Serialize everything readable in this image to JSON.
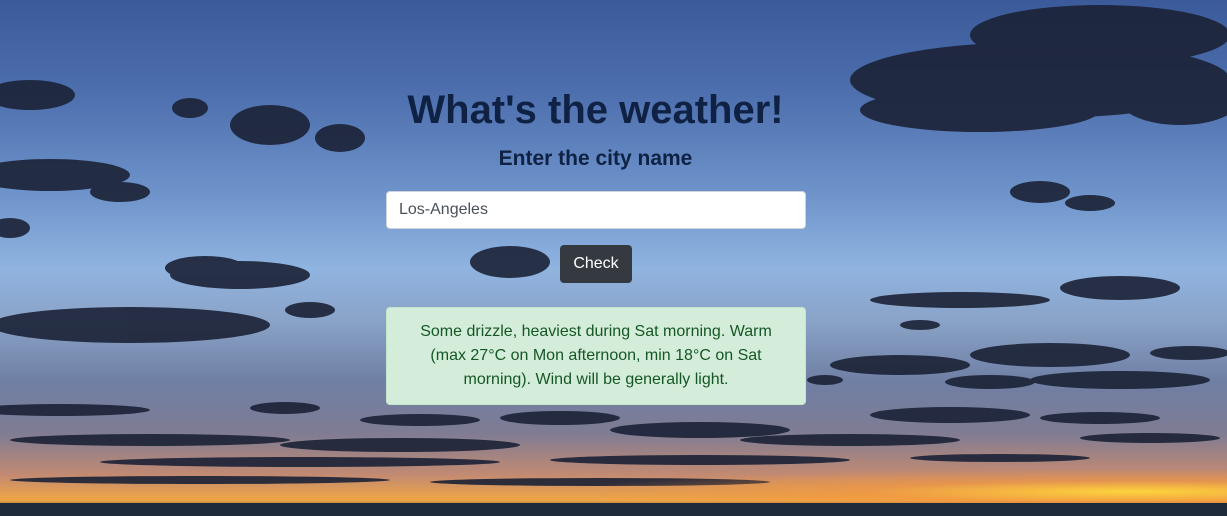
{
  "page": {
    "title": "What's the weather!",
    "subtitle": "Enter the city name"
  },
  "search": {
    "value": "Los-Angeles",
    "button_label": "Check"
  },
  "result": {
    "text": "Some drizzle, heaviest during Sat morning. Warm (max 27°C on Mon afternoon, min 18°C on Sat morning). Wind will be generally light."
  },
  "colors": {
    "title": "#0f2244",
    "button": "#343a40",
    "alert_background": "#d4edda",
    "alert_text": "#155724"
  }
}
